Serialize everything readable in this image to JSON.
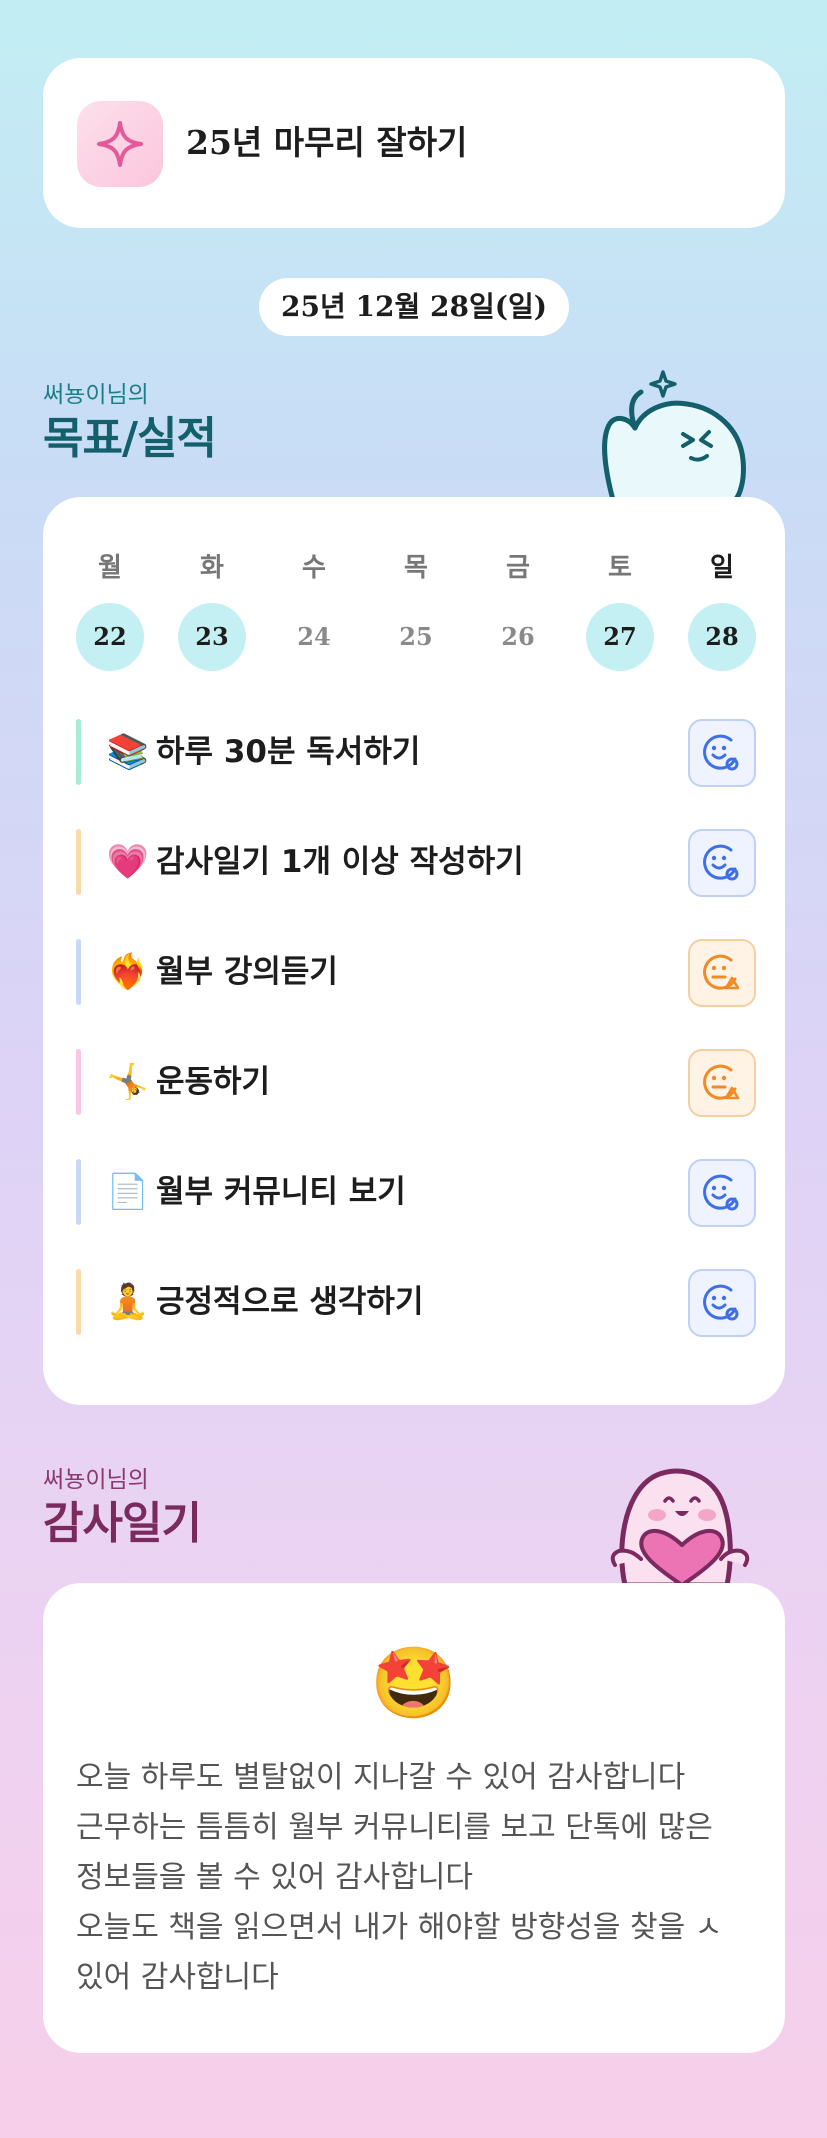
{
  "goal_banner": {
    "title": "25년 마무리 잘하기",
    "icon": "sparkle-icon"
  },
  "date": "25년 12월 28일(일)",
  "goals_section": {
    "subtitle": "써뇽이님의",
    "title": "목표/실적"
  },
  "week": {
    "days": [
      {
        "label": "월",
        "num": "22",
        "done": true
      },
      {
        "label": "화",
        "num": "23",
        "done": true
      },
      {
        "label": "수",
        "num": "24",
        "done": false
      },
      {
        "label": "목",
        "num": "25",
        "done": false
      },
      {
        "label": "금",
        "num": "26",
        "done": false
      },
      {
        "label": "토",
        "num": "27",
        "done": true
      },
      {
        "label": "일",
        "num": "28",
        "done": true
      }
    ]
  },
  "goals": [
    {
      "emoji": "📚",
      "text": "하루 30분 독서하기",
      "bar_color": "#a6ecd6",
      "mood": "good"
    },
    {
      "emoji": "💗",
      "text": "감사일기 1개 이상 작성하기",
      "bar_color": "#fbd9a8",
      "mood": "good"
    },
    {
      "emoji": "❤️‍🔥",
      "text": "월부 강의듣기",
      "bar_color": "#c9d8f8",
      "mood": "meh"
    },
    {
      "emoji": "🤸",
      "text": "운동하기",
      "bar_color": "#f9c6e4",
      "mood": "meh"
    },
    {
      "emoji": "📄",
      "text": "월부 커뮤니티 보기",
      "bar_color": "#c9d8f8",
      "mood": "good"
    },
    {
      "emoji": "🧘",
      "text": "긍정적으로 생각하기",
      "bar_color": "#fbd9a8",
      "mood": "good"
    }
  ],
  "colors": {
    "good": "#3f6fe6",
    "meh": "#f08a24",
    "accent_teal": "#145f6c",
    "accent_plum": "#7a2a5e"
  },
  "diary_section": {
    "subtitle": "써뇽이님의",
    "title": "감사일기"
  },
  "diary": {
    "emoji": "🤩",
    "lines": [
      "오늘 하루도 별탈없이 지나갈 수 있어 감사합니다",
      "근무하는 틈틈히 월부 커뮤니티를 보고 단톡에 많은",
      "정보들을 볼 수 있어 감사합니다",
      "오늘도 책을 읽으면서 내가 해야할 방향성을 찾을 ㅅ",
      "있어 감사합니다"
    ]
  }
}
